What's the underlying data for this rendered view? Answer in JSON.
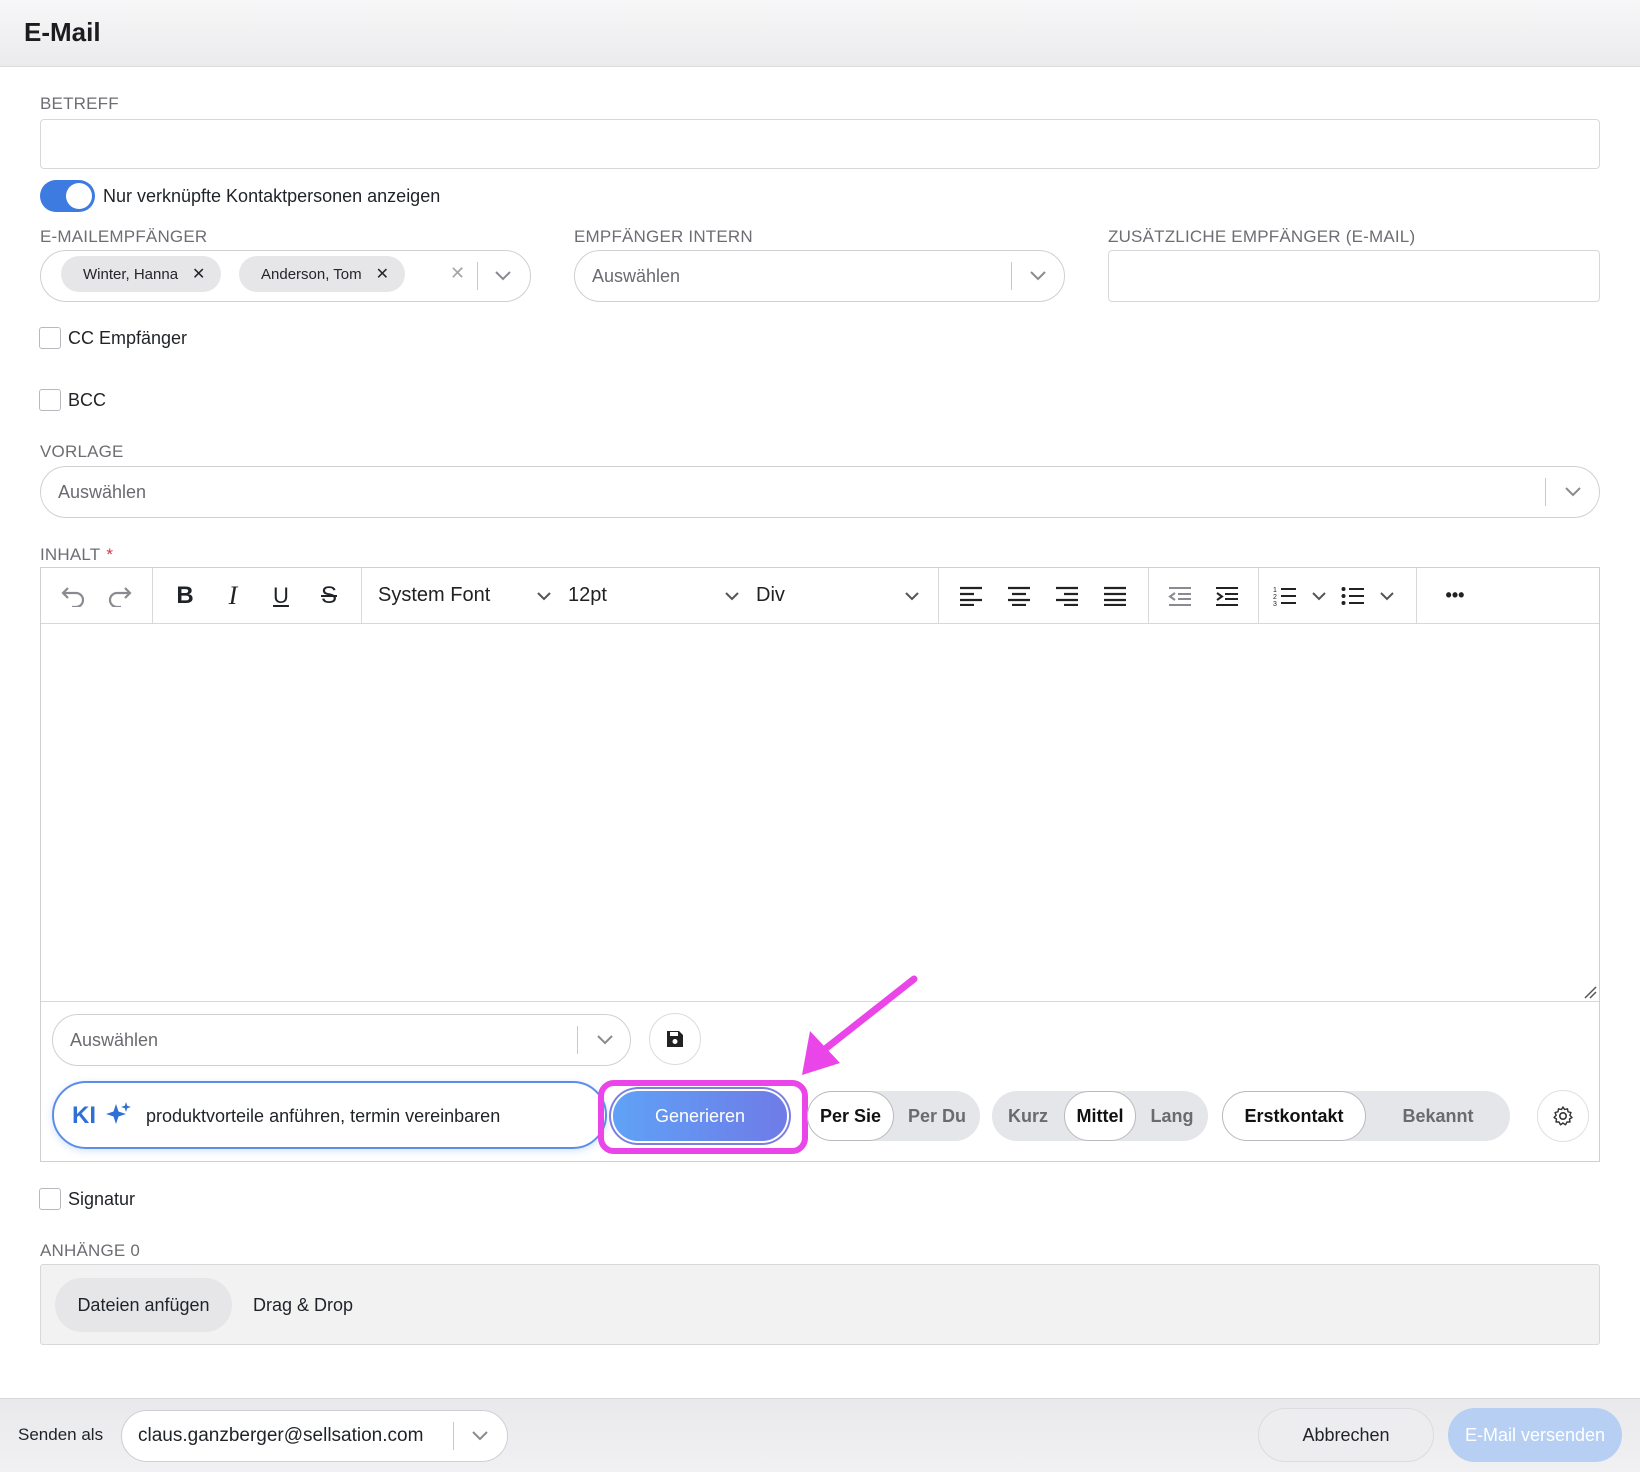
{
  "header": {
    "title": "E-Mail"
  },
  "subject": {
    "label": "BETREFF",
    "value": ""
  },
  "toggle": {
    "label": "Nur verknüpfte Kontaktpersonen anzeigen",
    "on": true
  },
  "recipients": {
    "label": "E-MAILEMPFÄNGER",
    "chips": [
      {
        "name": "Winter, Hanna",
        "remove": "✕"
      },
      {
        "name": "Anderson, Tom",
        "remove": "✕"
      }
    ],
    "clear": "✕"
  },
  "internal": {
    "label": "EMPFÄNGER INTERN",
    "placeholder": "Auswählen"
  },
  "additional": {
    "label": "ZUSÄTZLICHE EMPFÄNGER (E-MAIL)",
    "value": ""
  },
  "cc": {
    "label": "CC Empfänger",
    "checked": false
  },
  "bcc": {
    "label": "BCC",
    "checked": false
  },
  "template": {
    "label": "VORLAGE",
    "placeholder": "Auswählen"
  },
  "content": {
    "label": "INHALT",
    "required_mark": "*",
    "font": "System Font",
    "size": "12pt",
    "block": "Div",
    "more": "•••"
  },
  "snippet": {
    "placeholder": "Auswählen"
  },
  "ki": {
    "badge": "KI",
    "prompt": "produktvorteile anführen, termin vereinbaren",
    "generate": "Generieren",
    "address": [
      "Per Sie",
      "Per Du"
    ],
    "length": [
      "Kurz",
      "Mittel",
      "Lang"
    ],
    "length_selected": "Mittel",
    "relation": [
      "Erstkontakt",
      "Bekannt"
    ],
    "relation_selected": "Erstkontakt"
  },
  "signature": {
    "label": "Signatur",
    "checked": false
  },
  "attachments": {
    "label": "ANHÄNGE 0",
    "button": "Dateien anfügen",
    "drop": "Drag & Drop"
  },
  "footer": {
    "send_as_label": "Senden als",
    "send_as_value": "claus.ganzberger@sellsation.com",
    "cancel": "Abbrechen",
    "send": "E-Mail versenden"
  },
  "colors": {
    "accent": "#3d7be0",
    "highlight": "#ea45e8",
    "send_disabled": "#b6cff3"
  }
}
